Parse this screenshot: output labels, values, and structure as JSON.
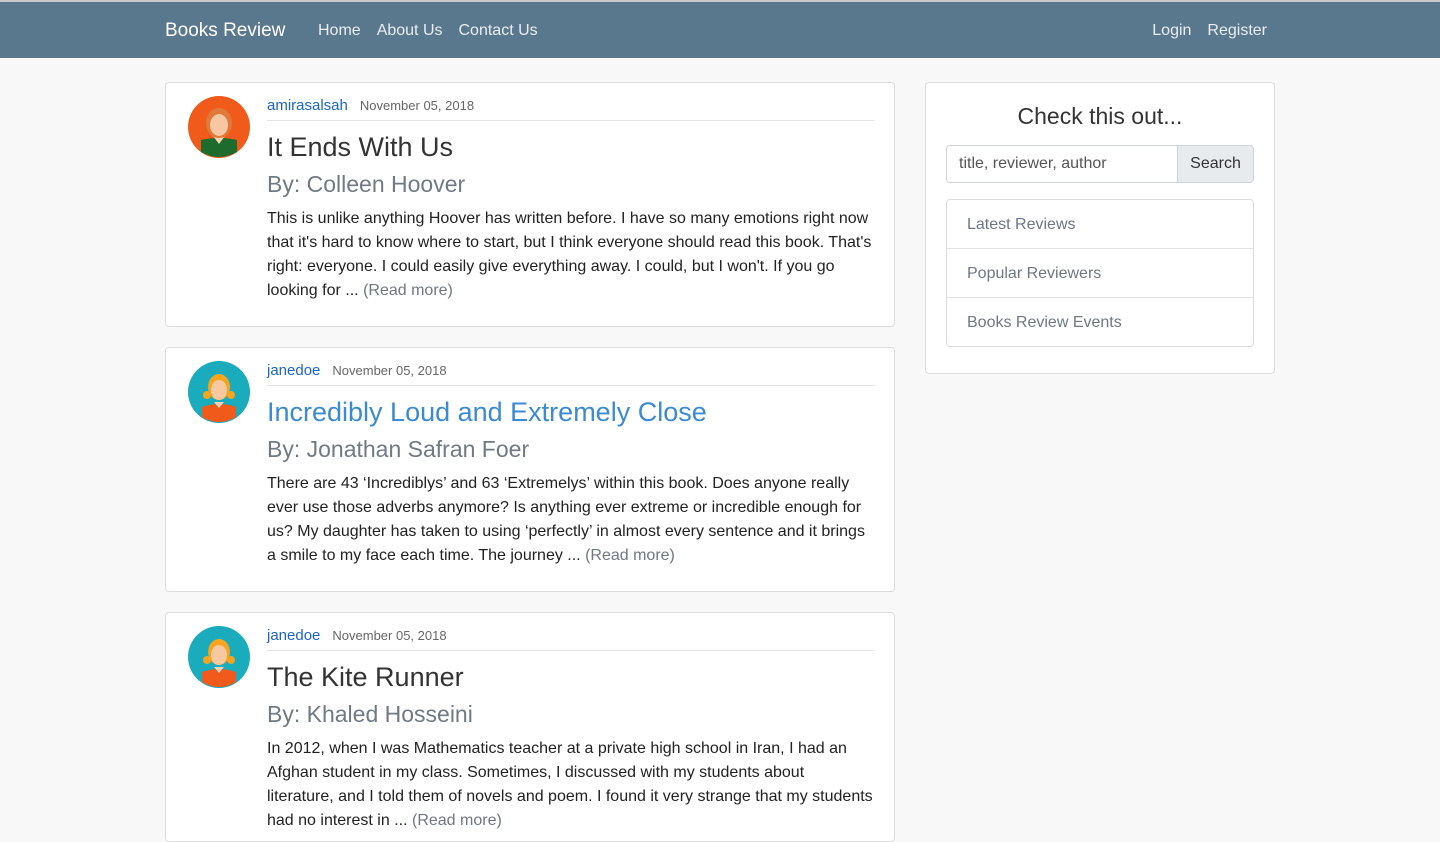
{
  "navbar": {
    "brand": "Books Review",
    "left_links": [
      "Home",
      "About Us",
      "Contact Us"
    ],
    "right_links": [
      "Login",
      "Register"
    ]
  },
  "posts": [
    {
      "avatar": "red-haired-woman-avatar",
      "author": "amirasalsah",
      "date": "November 05, 2018",
      "title": "It Ends With Us",
      "byline": "By: Colleen Hoover",
      "excerpt": "This is unlike anything Hoover has written before. I have so many emotions right now that it's hard to know where to start, but I think everyone should read this book. That's right: everyone. I could easily give everything away. I could, but I won't. If you go looking for ...",
      "readmore": "(Read more)"
    },
    {
      "avatar": "girl-avatar",
      "author": "janedoe",
      "date": "November 05, 2018",
      "title": "Incredibly Loud and Extremely Close",
      "byline": "By: Jonathan Safran Foer",
      "excerpt": "There are 43 ‘Incrediblys’ and 63 ‘Extremelys’ within this book. Does anyone really ever use those adverbs anymore? Is anything ever extreme or incredible enough for us? My daughter has taken to using ‘perfectly’ in almost every sentence and it brings a smile to my face each time. The journey ...",
      "readmore": "(Read more)"
    },
    {
      "avatar": "girl-avatar",
      "author": "janedoe",
      "date": "November 05, 2018",
      "title": "The Kite Runner",
      "byline": "By: Khaled Hosseini",
      "excerpt": "In 2012, when I was Mathematics teacher at a private high school in Iran, I had an Afghan student in my class. Sometimes, I discussed with my students about literature, and I told them of novels and poem. I found it very strange that my students had no interest in ...",
      "readmore": "(Read more)"
    }
  ],
  "sidebar": {
    "title": "Check this out...",
    "search_placeholder": "title, reviewer, author",
    "search_button": "Search",
    "items": [
      "Latest Reviews",
      "Popular Reviewers",
      "Books Review Events"
    ]
  },
  "colors": {
    "navbar": "#5a788d",
    "link": "#1a64c8",
    "title_hover": "#3a8ad4"
  }
}
